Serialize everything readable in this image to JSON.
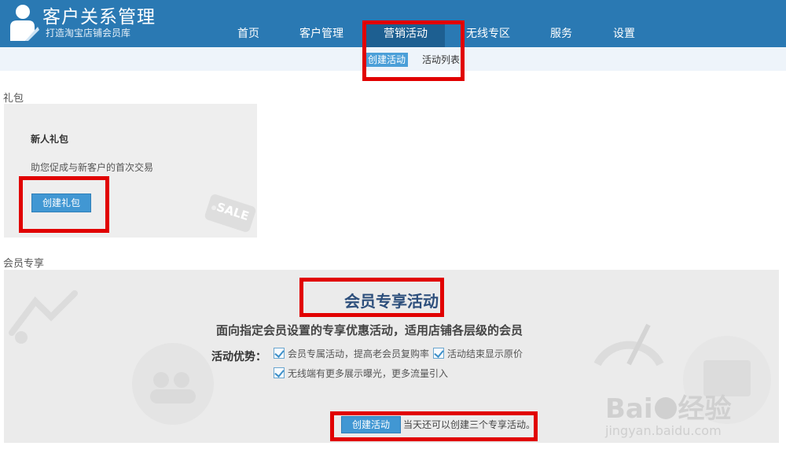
{
  "header": {
    "brand_title": "客户关系管理",
    "brand_subtitle": "打造淘宝店铺会员库",
    "nav": [
      {
        "label": "首页"
      },
      {
        "label": "客户管理"
      },
      {
        "label": "营销活动"
      },
      {
        "label": "无线专区"
      },
      {
        "label": "服务"
      },
      {
        "label": "设置"
      }
    ]
  },
  "subnav": {
    "items": [
      {
        "label": "创建活动"
      },
      {
        "label": "活动列表"
      }
    ]
  },
  "gift_section": {
    "label": "礼包",
    "card_title": "新人礼包",
    "card_desc": "助您促成与新客户的首次交易",
    "button": "创建礼包",
    "sale_text": "SALE"
  },
  "member_section": {
    "label": "会员专享",
    "title": "会员专享活动",
    "subtitle": "面向指定会员设置的专享优惠活动，适用店铺各层级的会员",
    "advantages_label": "活动优势：",
    "advantages": [
      "会员专属活动，提高老会员复购率",
      "活动结束显示原价",
      "无线端有更多展示曝光，更多流量引入"
    ],
    "button": "创建活动",
    "note": "当天还可以创建三个专享活动。"
  },
  "watermark": {
    "brand": "Bai",
    "brand_cn": "经验",
    "url": "jingyan.baidu.com"
  },
  "colors": {
    "header_bg": "#2a79b3",
    "nav_active_bg": "#1d5f91",
    "button_bg": "#4197d3",
    "highlight": "#e10000"
  }
}
